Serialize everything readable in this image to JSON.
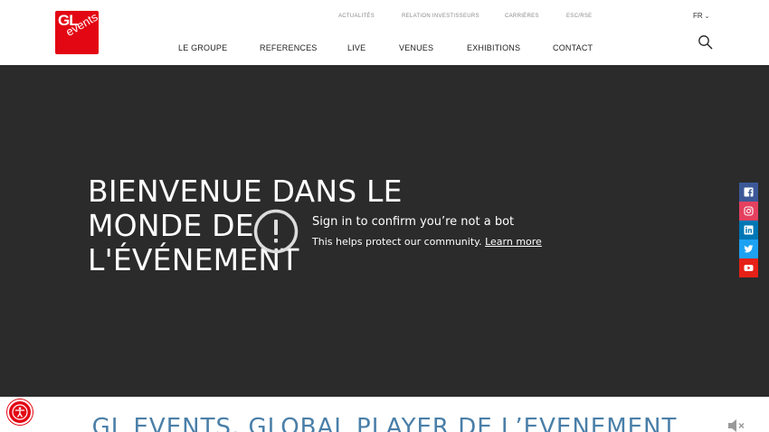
{
  "logo": {
    "line1": "GL",
    "line2": "events"
  },
  "top_nav": [
    "ACTUALITÉS",
    "RELATION INVESTISSEURS",
    "CARRIÈRES",
    "ESC/RSE"
  ],
  "language": "FR",
  "main_nav": [
    "LE GROUPE",
    "REFERENCES",
    "LIVE",
    "VENUES",
    "EXHIBITIONS",
    "CONTACT"
  ],
  "hero": {
    "title": "BIENVENUE DANS LE MONDE DE L'ÉVÉNEMENT",
    "notice_title": "Sign in to confirm you’re not a bot",
    "notice_sub": "This helps protect our community.",
    "notice_link": "Learn more"
  },
  "section_title": "GL EVENTS, GLOBAL PLAYER DE L’EVENEMENT",
  "colors": {
    "brand_red": "#e30613",
    "hero_bg": "#2b2b2b",
    "section_title": "#4a7fa8"
  },
  "social_icons": [
    "facebook-icon",
    "instagram-icon",
    "linkedin-icon",
    "twitter-icon",
    "youtube-icon"
  ]
}
